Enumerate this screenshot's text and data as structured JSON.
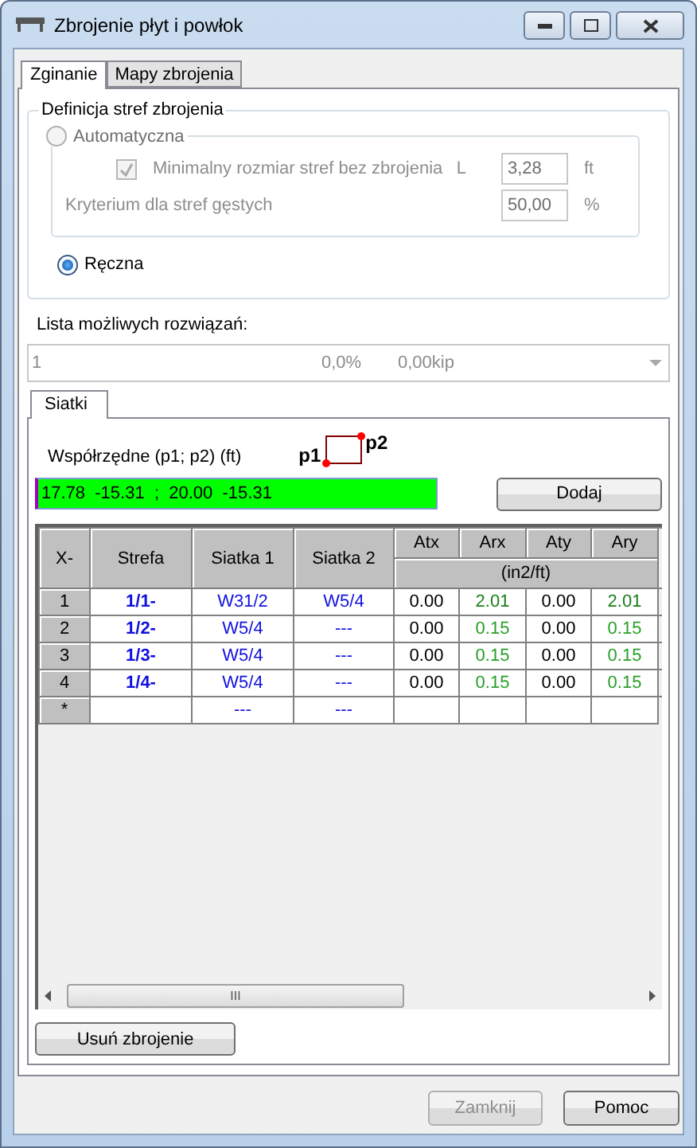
{
  "window": {
    "title": "Zbrojenie płyt i powłok"
  },
  "tabs": [
    {
      "label": "Zginanie",
      "selected": true
    },
    {
      "label": "Mapy zbrojenia",
      "selected": false
    }
  ],
  "zones": {
    "title": "Definicja stref zbrojenia",
    "modes": [
      {
        "label": "Automatyczna",
        "selected": false,
        "disabled": true
      },
      {
        "label": "Ręczna",
        "selected": true,
        "disabled": false
      }
    ],
    "min_size": {
      "label": "Minimalny rozmiar stref bez zbrojenia",
      "checked": true,
      "disabled": true,
      "symbol": "L",
      "value": "3,28",
      "unit": "ft"
    },
    "dense": {
      "label": "Kryterium dla stref gęstych",
      "disabled": true,
      "value": "50,00",
      "unit": "%"
    }
  },
  "solutions": {
    "label": "Lista możliwych rozwiązań:",
    "disabled": true,
    "value": [
      "1",
      "0,0%",
      "0,00kip"
    ]
  },
  "mesh_tabs": [
    {
      "label": "Siatki",
      "selected": true
    }
  ],
  "coords": {
    "label": "Współrzędne (p1; p2) (ft)",
    "p1": "p1",
    "p2": "p2",
    "value": "17.78  -15.31  ;  20.00  -15.31",
    "add_button": "Dodaj"
  },
  "table": {
    "columns": [
      "X-",
      "Strefa",
      "Siatka 1",
      "Siatka 2",
      "Atx",
      "Arx",
      "Aty",
      "Ary"
    ],
    "unit": "(in2/ft)",
    "rows": [
      {
        "header": "1",
        "zone": "1/1-",
        "mesh1": "W31/2",
        "mesh2": "W5/4",
        "atx": "0.00",
        "arx": "2.01",
        "aty": "0.00",
        "ary": "2.01",
        "color": "#1a7f1a"
      },
      {
        "header": "2",
        "zone": "1/2-",
        "mesh1": "W5/4",
        "mesh2": "---",
        "atx": "0.00",
        "arx": "0.15",
        "aty": "0.00",
        "ary": "0.15",
        "color": "#2aa02a"
      },
      {
        "header": "3",
        "zone": "1/3-",
        "mesh1": "W5/4",
        "mesh2": "---",
        "atx": "0.00",
        "arx": "0.15",
        "aty": "0.00",
        "ary": "0.15",
        "color": "#2aa02a"
      },
      {
        "header": "4",
        "zone": "1/4-",
        "mesh1": "W5/4",
        "mesh2": "---",
        "atx": "0.00",
        "arx": "0.15",
        "aty": "0.00",
        "ary": "0.15",
        "color": "#2aa02a"
      },
      {
        "header": "*",
        "mesh1": "---",
        "mesh2": "---"
      }
    ],
    "scroll_grip": "III"
  },
  "remove_button": "Usuń zbrojenie",
  "buttons": [
    {
      "label": "Zamknij",
      "disabled": true
    },
    {
      "label": "Pomoc",
      "disabled": false
    }
  ]
}
